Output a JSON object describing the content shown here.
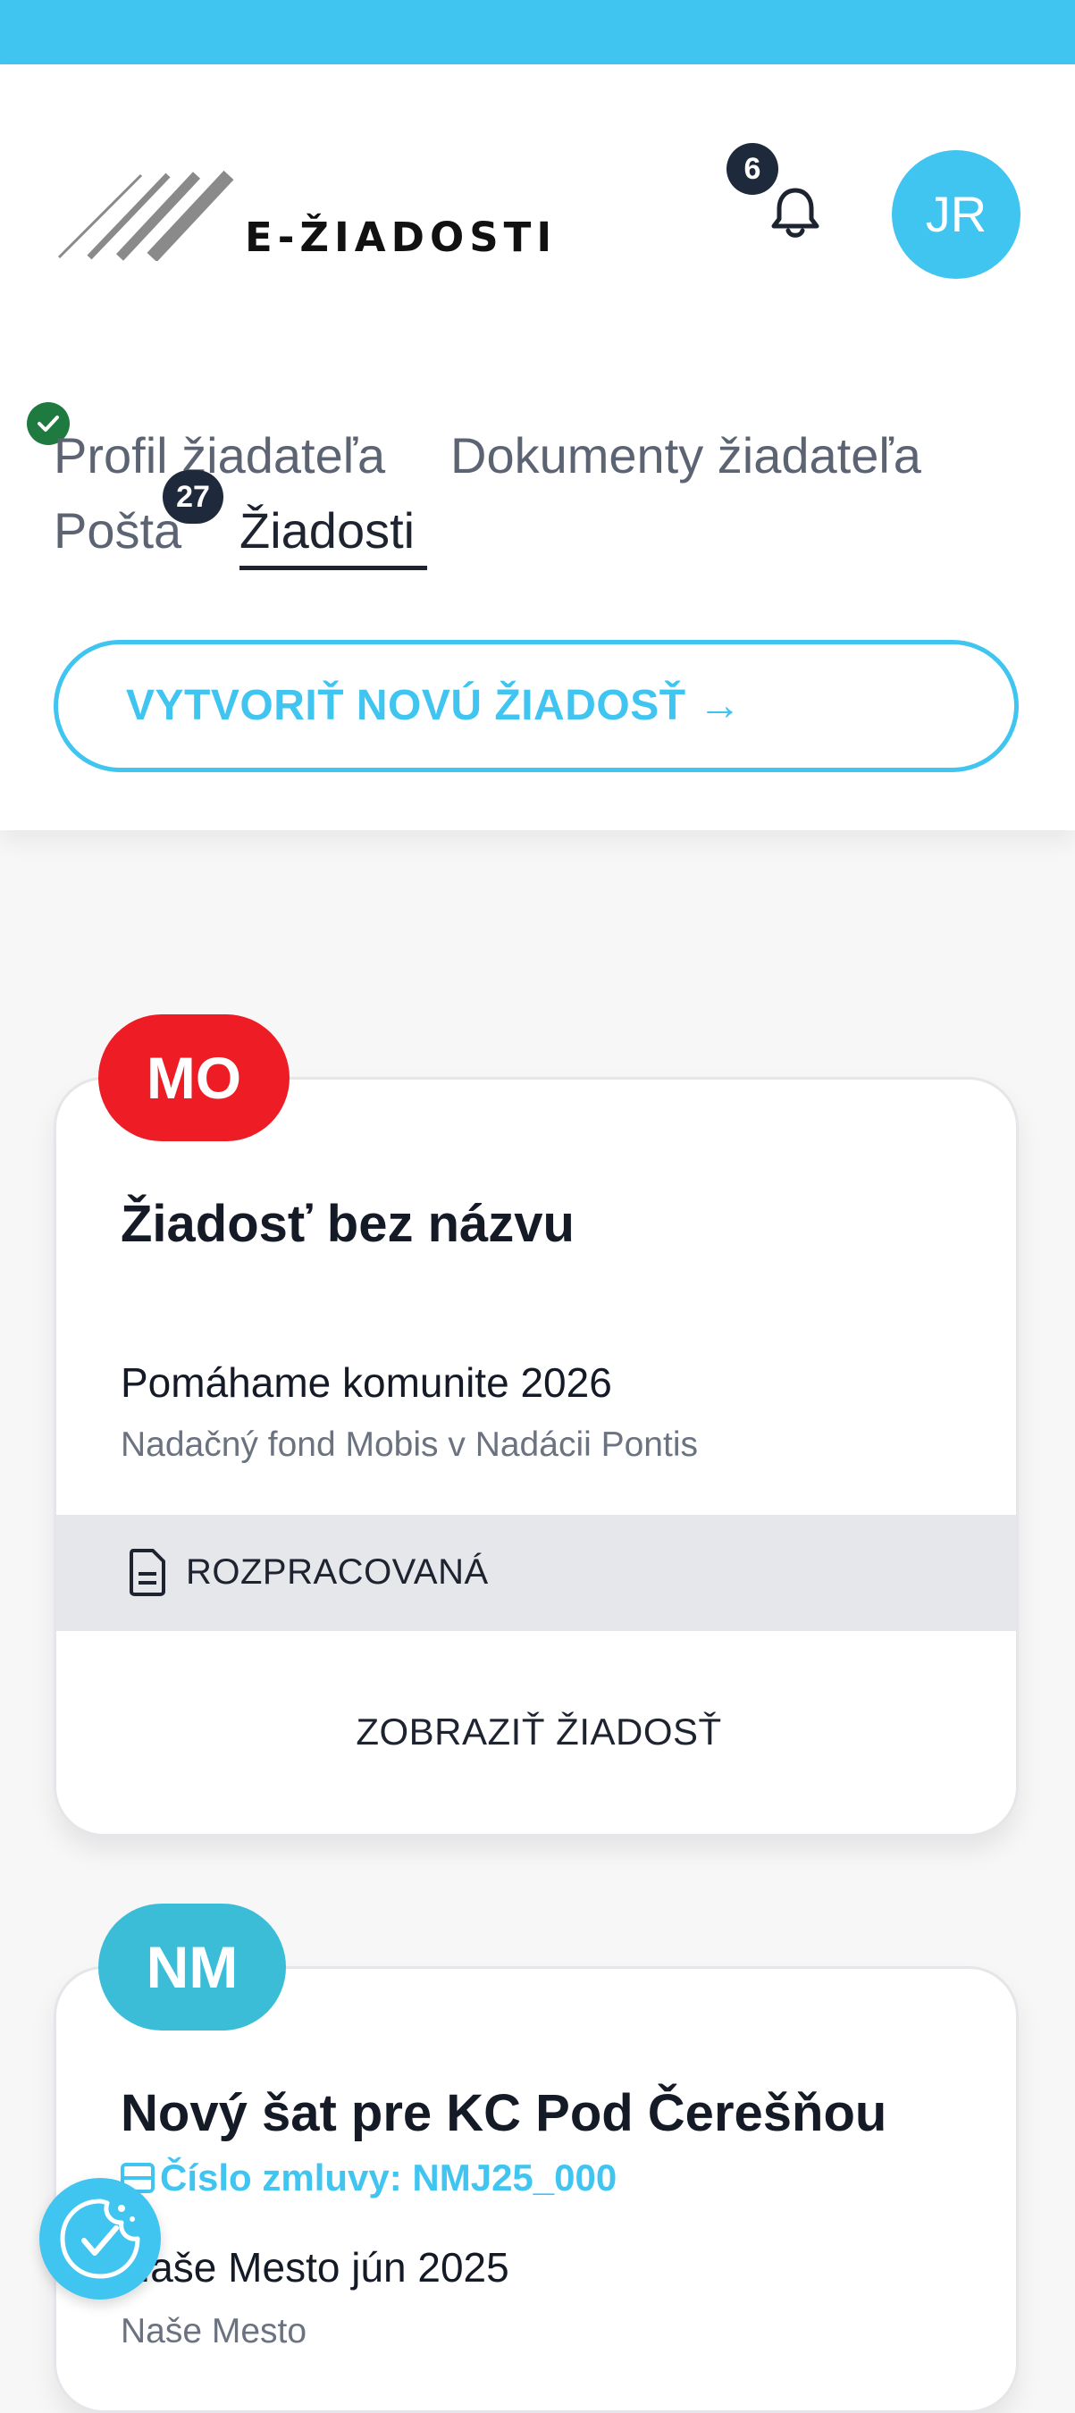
{
  "header": {
    "logo_text": "E-ŽIADOSTI",
    "notifications_count": "6",
    "avatar_initials": "JR",
    "accent_color": "#40c4f0"
  },
  "tabs": {
    "profil": "Profil žiadateľa",
    "dokumenty": "Dokumenty žiadateľa",
    "posta": "Pošta",
    "posta_badge": "27",
    "ziadosti": "Žiadosti"
  },
  "create_button": "VYTVORIŤ NOVÚ ŽIADOSŤ →",
  "applications": [
    {
      "initials": "MO",
      "initials_color": "#ee1c25",
      "title": "Žiadosť bez názvu",
      "program": "Pomáhame komunite 2026",
      "organization": "Nadačný fond Mobis v Nadácii Pontis",
      "status": "ROZPRACOVANÁ",
      "action": "ZOBRAZIŤ ŽIADOSŤ"
    },
    {
      "initials": "NM",
      "initials_color": "#3bbdd8",
      "title": "Nový šat pre KC Pod Čerešňou",
      "contract": "Číslo zmluvy: NMJ25_000",
      "program": "Naše Mesto jún 2025",
      "organization": "Naše Mesto"
    }
  ],
  "icons": [
    "bell-icon",
    "check-icon",
    "document-icon",
    "contract-icon",
    "cookie-consent-icon"
  ]
}
